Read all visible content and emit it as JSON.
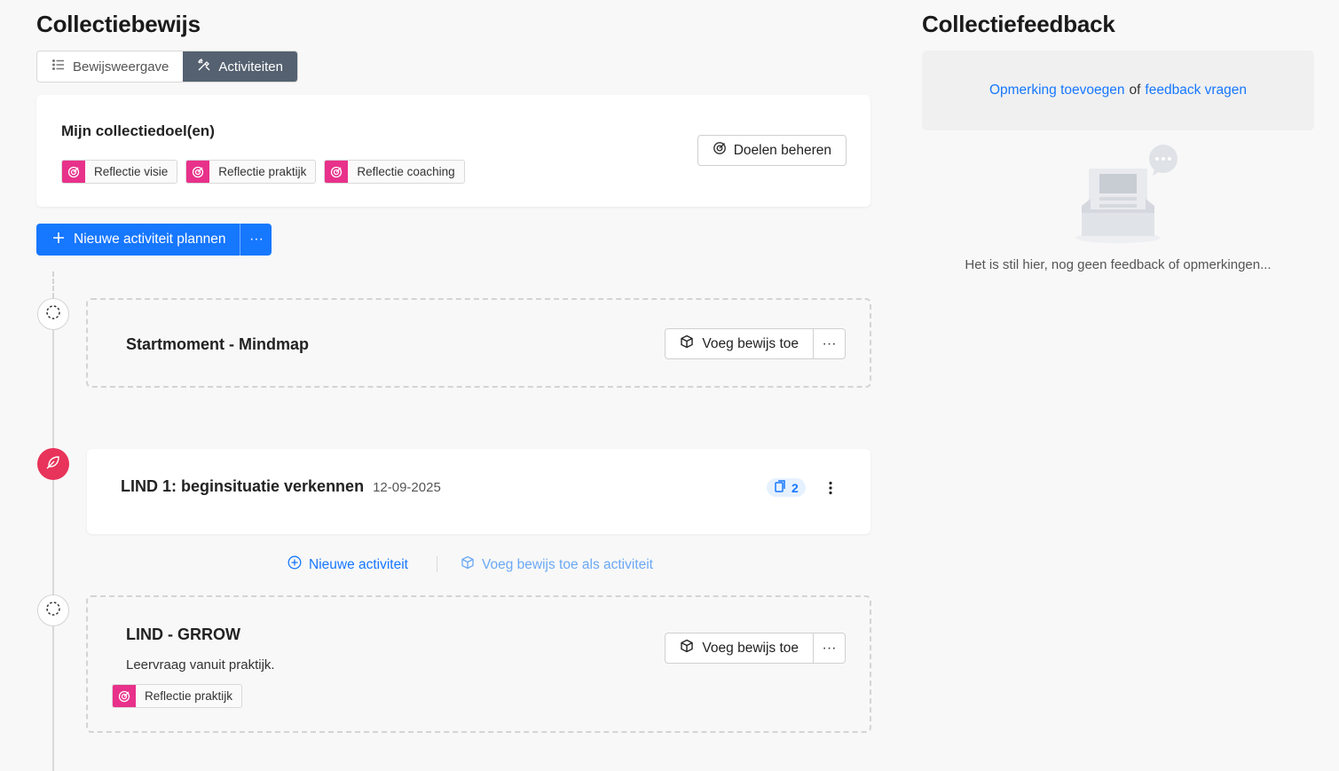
{
  "left": {
    "title": "Collectiebewijs",
    "tabs": [
      {
        "label": "Bewijsweergave",
        "icon": "list-icon",
        "active": false
      },
      {
        "label": "Activiteiten",
        "icon": "tools-icon",
        "active": true
      }
    ]
  },
  "goals": {
    "title": "Mijn collectiedoel(en)",
    "tags": [
      "Reflectie visie",
      "Reflectie praktijk",
      "Reflectie coaching"
    ],
    "manage_label": "Doelen beheren"
  },
  "primary": {
    "label": "Nieuwe activiteit plannen",
    "more": "···"
  },
  "activities": [
    {
      "title": "Startmoment - Mindmap",
      "action": "Voeg bewijs toe",
      "more": "···",
      "status": "planned"
    },
    {
      "title": "LIND 1: beginsituatie verkennen",
      "date": "12-09-2025",
      "evidence_count": "2",
      "status": "active"
    },
    {
      "title": "LIND - GRROW",
      "description": "Leervraag vanuit praktijk.",
      "tag": "Reflectie praktijk",
      "action": "Voeg bewijs toe",
      "more": "···",
      "status": "planned"
    }
  ],
  "insert": {
    "new_activity": "Nieuwe activiteit",
    "add_evidence_as_activity": "Voeg bewijs toe als activiteit"
  },
  "right": {
    "title": "Collectiefeedback",
    "add_comment": "Opmerking toevoegen",
    "or": "of",
    "request_feedback": "feedback vragen",
    "empty_text": "Het is stil hier, nog geen feedback of opmerkingen..."
  },
  "colors": {
    "primary": "#1677ff",
    "goal_tag": "#e8318a",
    "active_node": "#e8335a",
    "tab_active": "#556170"
  }
}
